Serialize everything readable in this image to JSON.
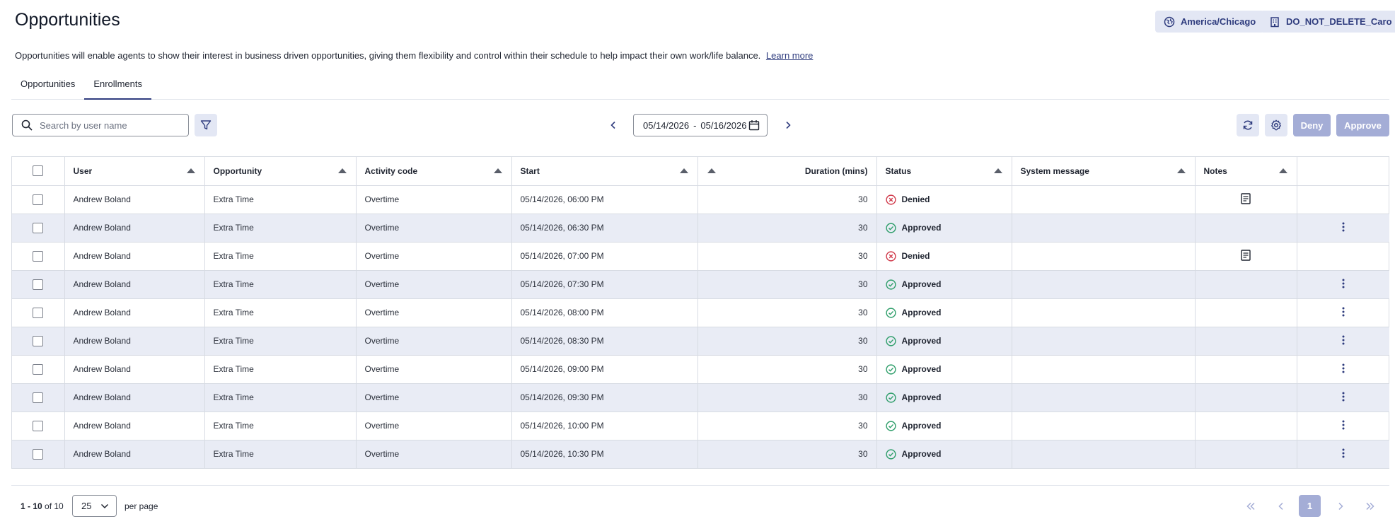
{
  "page": {
    "title": "Opportunities",
    "timezone_label": "America/Chicago",
    "org_label": "DO_NOT_DELETE_Caro",
    "description": "Opportunities will enable agents to show their interest in business driven opportunities, giving them flexibility and control within their schedule to help impact their own work/life balance.",
    "learn_more": "Learn more"
  },
  "tabs": [
    {
      "label": "Opportunities",
      "active": false
    },
    {
      "label": "Enrollments",
      "active": true
    }
  ],
  "toolbar": {
    "search_placeholder": "Search by user name",
    "date_start": "05/14/2026",
    "date_sep": "-",
    "date_end": "05/16/2026",
    "deny_label": "Deny",
    "approve_label": "Approve"
  },
  "table": {
    "columns": [
      "User",
      "Opportunity",
      "Activity code",
      "Start",
      "Duration (mins)",
      "Status",
      "System message",
      "Notes"
    ],
    "rows": [
      {
        "user": "Andrew Boland",
        "opportunity": "Extra Time",
        "activity": "Overtime",
        "start": "05/14/2026, 06:00 PM",
        "duration": "30",
        "status": "Denied",
        "has_note": true,
        "has_menu": false
      },
      {
        "user": "Andrew Boland",
        "opportunity": "Extra Time",
        "activity": "Overtime",
        "start": "05/14/2026, 06:30 PM",
        "duration": "30",
        "status": "Approved",
        "has_note": false,
        "has_menu": true
      },
      {
        "user": "Andrew Boland",
        "opportunity": "Extra Time",
        "activity": "Overtime",
        "start": "05/14/2026, 07:00 PM",
        "duration": "30",
        "status": "Denied",
        "has_note": true,
        "has_menu": false
      },
      {
        "user": "Andrew Boland",
        "opportunity": "Extra Time",
        "activity": "Overtime",
        "start": "05/14/2026, 07:30 PM",
        "duration": "30",
        "status": "Approved",
        "has_note": false,
        "has_menu": true
      },
      {
        "user": "Andrew Boland",
        "opportunity": "Extra Time",
        "activity": "Overtime",
        "start": "05/14/2026, 08:00 PM",
        "duration": "30",
        "status": "Approved",
        "has_note": false,
        "has_menu": true
      },
      {
        "user": "Andrew Boland",
        "opportunity": "Extra Time",
        "activity": "Overtime",
        "start": "05/14/2026, 08:30 PM",
        "duration": "30",
        "status": "Approved",
        "has_note": false,
        "has_menu": true
      },
      {
        "user": "Andrew Boland",
        "opportunity": "Extra Time",
        "activity": "Overtime",
        "start": "05/14/2026, 09:00 PM",
        "duration": "30",
        "status": "Approved",
        "has_note": false,
        "has_menu": true
      },
      {
        "user": "Andrew Boland",
        "opportunity": "Extra Time",
        "activity": "Overtime",
        "start": "05/14/2026, 09:30 PM",
        "duration": "30",
        "status": "Approved",
        "has_note": false,
        "has_menu": true
      },
      {
        "user": "Andrew Boland",
        "opportunity": "Extra Time",
        "activity": "Overtime",
        "start": "05/14/2026, 10:00 PM",
        "duration": "30",
        "status": "Approved",
        "has_note": false,
        "has_menu": true
      },
      {
        "user": "Andrew Boland",
        "opportunity": "Extra Time",
        "activity": "Overtime",
        "start": "05/14/2026, 10:30 PM",
        "duration": "30",
        "status": "Approved",
        "has_note": false,
        "has_menu": true
      }
    ]
  },
  "pagination": {
    "range": "1 - 10",
    "of_label": "of 10",
    "per_page_value": "25",
    "per_page_label": "per page",
    "current_page": "1"
  },
  "colors": {
    "accent": "#2f3c7e",
    "approved": "#2e9e6a",
    "denied": "#d0394a",
    "disabled_button": "#a4add6"
  }
}
